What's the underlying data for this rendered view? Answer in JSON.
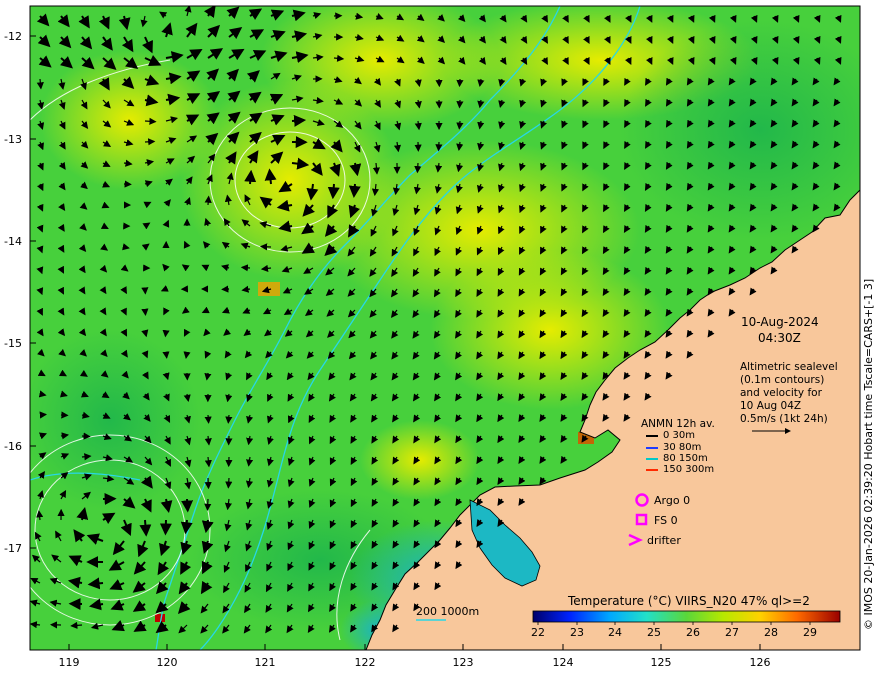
{
  "map": {
    "lat_ticks": [
      "-12",
      "-13",
      "-14",
      "-15",
      "-16",
      "-17"
    ],
    "lon_ticks": [
      "119",
      "120",
      "121",
      "122",
      "123",
      "124",
      "125",
      "126"
    ],
    "date_label": "10-Aug-2024",
    "time_label": "04:30Z",
    "description_lines": [
      "Altimetric sealevel",
      "(0.1m contours)",
      "and velocity for",
      "10 Aug 04Z",
      "0.5m/s (1kt 24h)"
    ],
    "anmn_title": "ANMN 12h av.",
    "anmn_legend": [
      {
        "label": "0 30m",
        "color": "#000000"
      },
      {
        "label": "30 80m",
        "color": "#1f3bff"
      },
      {
        "label": "80 150m",
        "color": "#00c8c8"
      },
      {
        "label": "150 300m",
        "color": "#ff2a00"
      }
    ],
    "markers": [
      {
        "label": "Argo 0",
        "color": "#ff00ff",
        "icon": "circle-icon"
      },
      {
        "label": "FS 0",
        "color": "#ff00ff",
        "icon": "square-icon"
      },
      {
        "label": "drifter",
        "color": "#ff00ff",
        "icon": "chevron-right-icon"
      }
    ],
    "isobath_label": "200  1000m",
    "colorbar_title": "Temperature (°C) VIIRS_N20 47% ql>=2",
    "colorbar_ticks": [
      "22",
      "23",
      "24",
      "25",
      "26",
      "27",
      "28",
      "29"
    ],
    "credit": "© IMOS 20-Jan-2026 02:39:20 Hobart time Tscale=CARS+[-1 3]",
    "colors": {
      "land": "#f8c79b",
      "ocean_green": "#3ccd3c",
      "ocean_yellow": "#d6ea00",
      "ocean_cyan": "#2ab4c8",
      "isobath": "#28d7e6",
      "arrow": "#000000"
    }
  }
}
